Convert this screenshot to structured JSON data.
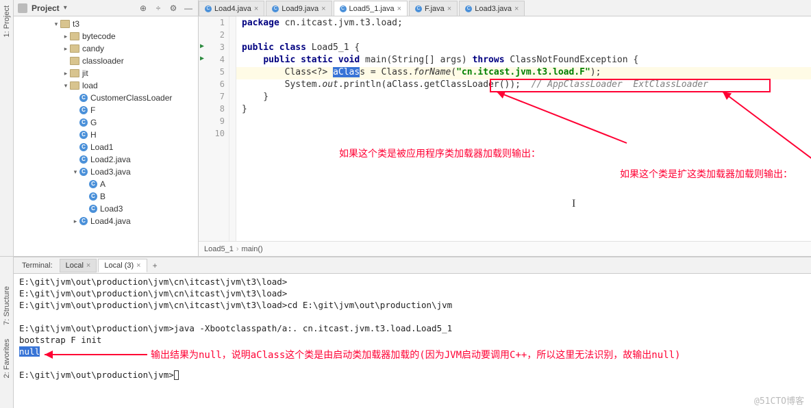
{
  "projectPanel": {
    "title": "Project",
    "items": [
      {
        "depth": 4,
        "tw": "v",
        "type": "folder",
        "name": "t3"
      },
      {
        "depth": 5,
        "tw": ">",
        "type": "folder",
        "name": "bytecode"
      },
      {
        "depth": 5,
        "tw": ">",
        "type": "folder",
        "name": "candy"
      },
      {
        "depth": 5,
        "tw": "",
        "type": "folder",
        "name": "classloader"
      },
      {
        "depth": 5,
        "tw": ">",
        "type": "folder",
        "name": "jit"
      },
      {
        "depth": 5,
        "tw": "v",
        "type": "folder",
        "name": "load"
      },
      {
        "depth": 6,
        "tw": "",
        "type": "class",
        "name": "CustomerClassLoader"
      },
      {
        "depth": 6,
        "tw": "",
        "type": "class",
        "name": "F"
      },
      {
        "depth": 6,
        "tw": "",
        "type": "class",
        "name": "G"
      },
      {
        "depth": 6,
        "tw": "",
        "type": "class",
        "name": "H"
      },
      {
        "depth": 6,
        "tw": "",
        "type": "class",
        "name": "Load1"
      },
      {
        "depth": 6,
        "tw": "",
        "type": "class",
        "name": "Load2.java"
      },
      {
        "depth": 6,
        "tw": "v",
        "type": "class",
        "name": "Load3.java"
      },
      {
        "depth": 7,
        "tw": "",
        "type": "class",
        "name": "A"
      },
      {
        "depth": 7,
        "tw": "",
        "type": "class",
        "name": "B"
      },
      {
        "depth": 7,
        "tw": "",
        "type": "class",
        "name": "Load3"
      },
      {
        "depth": 6,
        "tw": ">",
        "type": "class",
        "name": "Load4.java"
      }
    ]
  },
  "tabs": [
    {
      "name": "Load4.java",
      "active": false
    },
    {
      "name": "Load9.java",
      "active": false
    },
    {
      "name": "Load5_1.java",
      "active": true
    },
    {
      "name": "F.java",
      "active": false
    },
    {
      "name": "Load3.java",
      "active": false
    }
  ],
  "code": {
    "lines": [
      {
        "n": 1,
        "run": false,
        "t": [
          [
            "kw",
            "package"
          ],
          "",
          " cn.itcast.jvm.t3.load;"
        ]
      },
      {
        "n": 2,
        "run": false,
        "t": [
          ""
        ]
      },
      {
        "n": 3,
        "run": true,
        "t": [
          [
            "kw",
            "public class"
          ],
          "",
          " Load5_1 {"
        ]
      },
      {
        "n": 4,
        "run": true,
        "t": [
          "    ",
          [
            "kw",
            "public static void"
          ],
          " main(String[] args) ",
          [
            "kw",
            "throws"
          ],
          " ClassNotFoundException {"
        ]
      },
      {
        "n": 5,
        "run": false,
        "hl": true,
        "t": [
          "        Class<?> ",
          [
            "sel",
            "aClas"
          ],
          "s = Class.",
          [
            "fn",
            "forName"
          ],
          "(",
          [
            "str",
            "\"cn.itcast.jvm.t3.load.F\""
          ],
          ");"
        ]
      },
      {
        "n": 6,
        "run": false,
        "t": [
          "        System.",
          [
            "fn",
            "out"
          ],
          ".println(aClass.getClassLoader());  ",
          [
            "cmt",
            "// AppClassLoader  ExtClassLoader"
          ]
        ]
      },
      {
        "n": 7,
        "run": false,
        "t": [
          "    }"
        ]
      },
      {
        "n": 8,
        "run": false,
        "t": [
          "}"
        ]
      },
      {
        "n": 9,
        "run": false,
        "t": [
          ""
        ]
      },
      {
        "n": 10,
        "run": false,
        "t": [
          ""
        ]
      }
    ]
  },
  "breadcrumb": [
    "Load5_1",
    "main()"
  ],
  "annotations": {
    "a1": "如果这个类是被应用程序类加载器加载则输出：",
    "a2": "如果这个类是扩这类加载器加载则输出：",
    "a3": "输出结果为null，说明aClass这个类是由启动类加载器加载的(因为JVM启动要调用C++，所以这里无法识别，故输出null)"
  },
  "terminal": {
    "title": "Terminal:",
    "tabs": [
      {
        "name": "Local",
        "active": false
      },
      {
        "name": "Local (3)",
        "active": true
      }
    ],
    "lines": [
      "E:\\git\\jvm\\out\\production\\jvm\\cn\\itcast\\jvm\\t3\\load>",
      "E:\\git\\jvm\\out\\production\\jvm\\cn\\itcast\\jvm\\t3\\load>",
      "E:\\git\\jvm\\out\\production\\jvm\\cn\\itcast\\jvm\\t3\\load>cd E:\\git\\jvm\\out\\production\\jvm",
      "",
      "E:\\git\\jvm\\out\\production\\jvm>java -Xbootclasspath/a:. cn.itcast.jvm.t3.load.Load5_1",
      "bootstrap F init"
    ],
    "nullText": "null",
    "promptLast": "E:\\git\\jvm\\out\\production\\jvm>"
  },
  "sideLabels": {
    "project": "1: Project",
    "structure": "7: Structure",
    "favorites": "2: Favorites"
  },
  "watermark": "@51CTO博客"
}
